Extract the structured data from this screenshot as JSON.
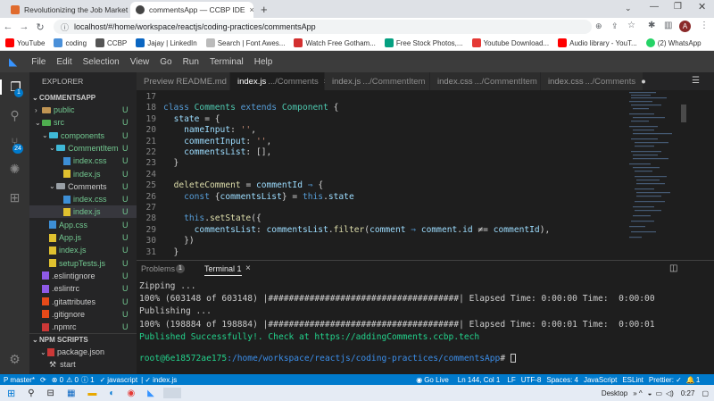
{
  "browser": {
    "tabs": [
      {
        "title": "Revolutionizing the Job Market |",
        "color": "#e06b2d"
      },
      {
        "title": "commentsApp — CCBP IDE",
        "color": "#444"
      }
    ],
    "url": "localhost/#/home/workspace/reactjs/coding-practices/commentsApp",
    "profile": "A",
    "bookmarks": [
      {
        "label": "YouTube",
        "color": "#ff0000"
      },
      {
        "label": "coding",
        "color": "#4a90d9"
      },
      {
        "label": "CCBP",
        "color": "#555"
      },
      {
        "label": "Jajay | LinkedIn",
        "color": "#0a66c2"
      },
      {
        "label": "Search | Font Awes...",
        "color": "#777"
      },
      {
        "label": "Watch Free Gotham...",
        "color": "#d32f2f"
      },
      {
        "label": "Free Stock Photos,...",
        "color": "#05a081"
      },
      {
        "label": "Youtube Download...",
        "color": "#e53935"
      },
      {
        "label": "Audio library - YouT...",
        "color": "#ff0000"
      },
      {
        "label": "(2) WhatsApp",
        "color": "#25d366"
      }
    ]
  },
  "menu": [
    "File",
    "Edit",
    "Selection",
    "View",
    "Go",
    "Run",
    "Terminal",
    "Help"
  ],
  "explorer": {
    "title": "EXPLORER",
    "project": "COMMENTSAPP",
    "npm": "NPM SCRIPTS",
    "items": [
      {
        "name": "public",
        "status": "U"
      },
      {
        "name": "src",
        "status": "U"
      },
      {
        "name": "components",
        "status": "U"
      },
      {
        "name": "CommentItem",
        "status": "U"
      },
      {
        "name": "index.css",
        "status": "U"
      },
      {
        "name": "index.js",
        "status": "U"
      },
      {
        "name": "Comments",
        "status": "U"
      },
      {
        "name": "index.css",
        "status": "U"
      },
      {
        "name": "index.js",
        "status": "U"
      },
      {
        "name": "App.css",
        "status": "U"
      },
      {
        "name": "App.js",
        "status": "U"
      },
      {
        "name": "index.js",
        "status": "U"
      },
      {
        "name": "setupTests.js",
        "status": "U"
      },
      {
        "name": ".eslintignore",
        "status": "U"
      },
      {
        "name": ".eslintrc",
        "status": "U"
      },
      {
        "name": ".gitattributes",
        "status": "U"
      },
      {
        "name": ".gitignore",
        "status": "U"
      },
      {
        "name": ".npmrc",
        "status": "U"
      }
    ],
    "npm_items": [
      {
        "name": "package.json"
      },
      {
        "name": "start"
      }
    ]
  },
  "editor_tabs": [
    {
      "name": "Preview README.md",
      "sub": ""
    },
    {
      "name": "index.js",
      "sub": ".../Comments",
      "close": "×"
    },
    {
      "name": "index.js",
      "sub": ".../CommentItem"
    },
    {
      "name": "index.css",
      "sub": ".../CommentItem"
    },
    {
      "name": "index.css",
      "sub": ".../Comments",
      "dot": "●"
    }
  ],
  "code_lines": [
    {
      "n": "17",
      "t": []
    },
    {
      "n": "18",
      "t": [
        [
          "kw",
          "class "
        ],
        [
          "cls",
          "Comments "
        ],
        [
          "kw",
          "extends "
        ],
        [
          "cls",
          "Component "
        ],
        [
          "pl",
          "{"
        ]
      ]
    },
    {
      "n": "19",
      "t": [
        [
          "pl",
          "  "
        ],
        [
          "prop",
          "state "
        ],
        [
          "pl",
          "= {"
        ]
      ]
    },
    {
      "n": "20",
      "t": [
        [
          "pl",
          "    "
        ],
        [
          "prop",
          "nameInput"
        ],
        [
          "pl",
          ": "
        ],
        [
          "str",
          "''"
        ],
        [
          "pl",
          ","
        ]
      ]
    },
    {
      "n": "21",
      "t": [
        [
          "pl",
          "    "
        ],
        [
          "prop",
          "commentInput"
        ],
        [
          "pl",
          ": "
        ],
        [
          "str",
          "''"
        ],
        [
          "pl",
          ","
        ]
      ]
    },
    {
      "n": "22",
      "t": [
        [
          "pl",
          "    "
        ],
        [
          "prop",
          "commentsList"
        ],
        [
          "pl",
          ": [],"
        ]
      ]
    },
    {
      "n": "23",
      "t": [
        [
          "pl",
          "  }"
        ]
      ]
    },
    {
      "n": "24",
      "t": []
    },
    {
      "n": "25",
      "t": [
        [
          "pl",
          "  "
        ],
        [
          "fn",
          "deleteComment "
        ],
        [
          "pl",
          "= "
        ],
        [
          "prop",
          "commentId "
        ],
        [
          "kw",
          "⇒ "
        ],
        [
          "pl",
          "{"
        ]
      ]
    },
    {
      "n": "26",
      "t": [
        [
          "pl",
          "    "
        ],
        [
          "kw",
          "const "
        ],
        [
          "pl",
          "{"
        ],
        [
          "prop",
          "commentsList"
        ],
        [
          "pl",
          "} = "
        ],
        [
          "kw",
          "this"
        ],
        [
          "pl",
          "."
        ],
        [
          "prop",
          "state"
        ]
      ]
    },
    {
      "n": "27",
      "t": []
    },
    {
      "n": "28",
      "t": [
        [
          "pl",
          "    "
        ],
        [
          "kw",
          "this"
        ],
        [
          "pl",
          "."
        ],
        [
          "fn",
          "setState"
        ],
        [
          "pl",
          "({"
        ]
      ]
    },
    {
      "n": "29",
      "t": [
        [
          "pl",
          "      "
        ],
        [
          "prop",
          "commentsList"
        ],
        [
          "pl",
          ": "
        ],
        [
          "prop",
          "commentsList"
        ],
        [
          "pl",
          "."
        ],
        [
          "fn",
          "filter"
        ],
        [
          "pl",
          "("
        ],
        [
          "prop",
          "comment "
        ],
        [
          "kw",
          "⇒ "
        ],
        [
          "prop",
          "comment"
        ],
        [
          "pl",
          "."
        ],
        [
          "prop",
          "id "
        ],
        [
          "pl",
          "≠= "
        ],
        [
          "prop",
          "commentId"
        ],
        [
          "pl",
          "),"
        ]
      ]
    },
    {
      "n": "30",
      "t": [
        [
          "pl",
          "    })"
        ]
      ]
    },
    {
      "n": "31",
      "t": [
        [
          "pl",
          "  }"
        ]
      ]
    }
  ],
  "panel": {
    "problems": "Problems",
    "problems_count": "1",
    "terminal": "Terminal 1",
    "close": "×"
  },
  "terminal_lines": [
    {
      "text": "Zipping ...",
      "color": "#ccc"
    },
    {
      "text": "100% (603148 of 603148) |#####################################| Elapsed Time: 0:00:00 Time:  0:00:00",
      "color": "#ccc"
    },
    {
      "text": "Publishing ...",
      "color": "#ccc"
    },
    {
      "text": "100% (198884 of 198884) |#####################################| Elapsed Time: 0:00:01 Time:  0:00:01",
      "color": "#ccc"
    },
    {
      "text": "Published Successfully!. Check at https://addingComments.ccbp.tech",
      "color": "#23d18b"
    },
    {
      "text": "",
      "color": "#ccc"
    }
  ],
  "prompt": {
    "user": "root@6e18572ae175",
    "path": ":/home/workspace/reactjs/coding-practices/commentsApp",
    "end": "# "
  },
  "status": {
    "branch": "P master*",
    "sync": "⟳",
    "errors": "⊗ 0",
    "warnings": "⚠ 0",
    "info": "ⓘ 1",
    "lang_left": "javascript",
    "file_left": "index.js",
    "golive": "Go Live",
    "pos": "Ln 144, Col 1",
    "eol": "LF",
    "enc": "UTF-8",
    "spaces": "Spaces: 4",
    "lang": "JavaScript",
    "eslint": "ESLint",
    "prettier": "Prettier: ✓",
    "bell": "1"
  },
  "taskbar": {
    "desktop": "Desktop",
    "time": "0:27"
  }
}
